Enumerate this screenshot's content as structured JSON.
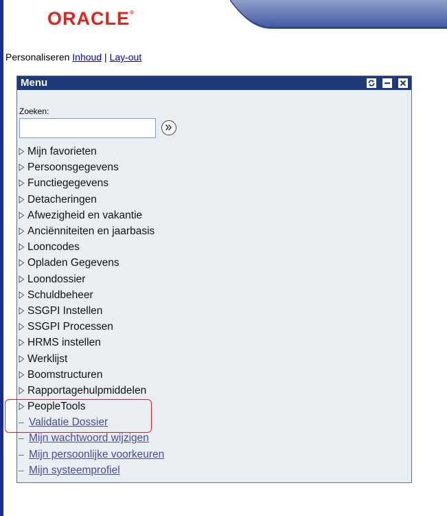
{
  "logo": {
    "text": "ORACLE",
    "mark": "®"
  },
  "personalize": {
    "label": "Personaliseren",
    "link_content": "Inhoud",
    "separator": "|",
    "link_layout": "Lay-out"
  },
  "menu": {
    "title": "Menu",
    "search_label": "Zoeken:",
    "search_value": "",
    "folders": [
      "Mijn favorieten",
      "Persoonsgegevens",
      "Functiegegevens",
      "Detacheringen",
      "Afwezigheid en vakantie",
      "Anciënniteiten en jaarbasis",
      "Looncodes",
      "Opladen Gegevens",
      "Loondossier",
      "Schuldbeheer",
      "SSGPI Instellen",
      "SSGPI Processen",
      "HRMS instellen",
      "Werklijst",
      "Boomstructuren",
      "Rapportagehulpmiddelen",
      "PeopleTools"
    ],
    "links": [
      "Validatie Dossier",
      "Mijn wachtwoord wijzigen",
      "Mijn persoonlijke voorkeuren",
      "Mijn systeemprofiel"
    ]
  },
  "colors": {
    "brand_red": "#e2231a",
    "titlebar": "#1f3a7a",
    "left_bar": "#1d2c8c",
    "highlight": "#e0202a",
    "link": "#4a4a9c"
  }
}
